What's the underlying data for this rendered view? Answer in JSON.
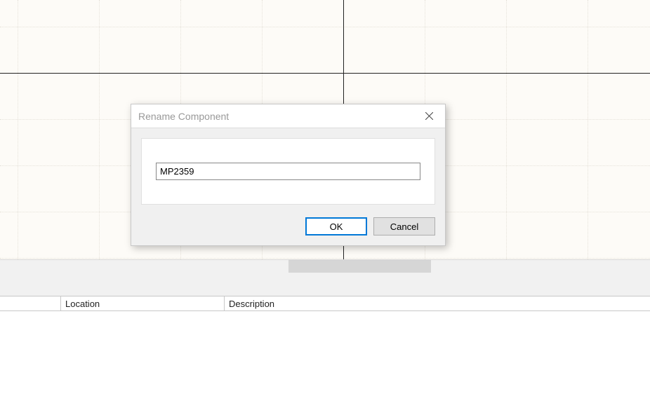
{
  "dialog": {
    "title": "Rename Component",
    "input_value": "MP2359",
    "ok_label": "OK",
    "cancel_label": "Cancel"
  },
  "columns": {
    "location_label": "Location",
    "description_label": "Description"
  }
}
